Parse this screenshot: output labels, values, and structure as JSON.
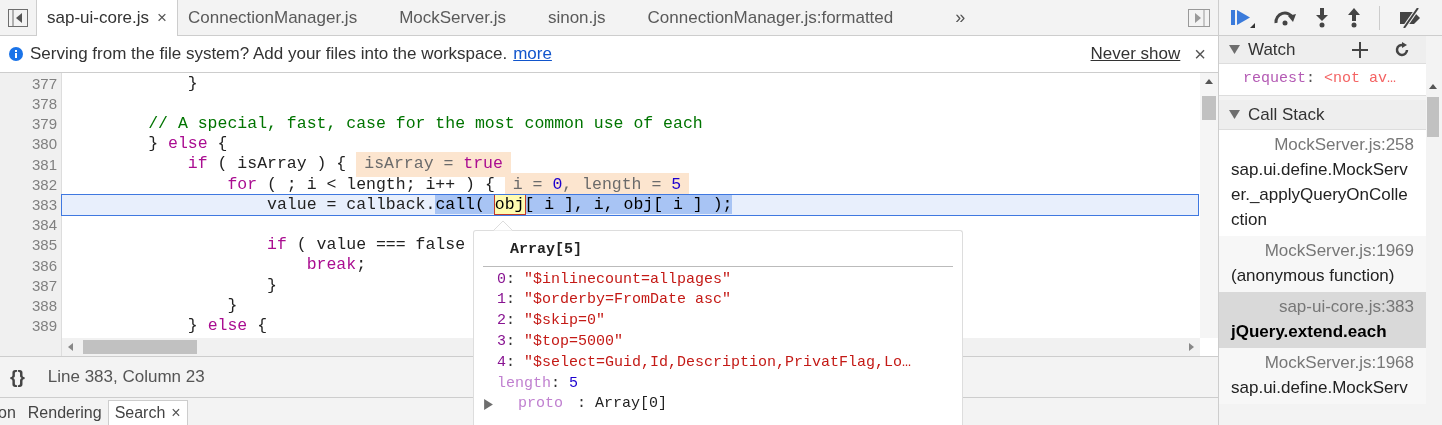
{
  "editor_tabs": [
    {
      "label": "sap-ui-core.js",
      "selected": true,
      "close": "×"
    },
    {
      "label": "ConnectionManager.js",
      "selected": false
    },
    {
      "label": "MockServer.js",
      "selected": false
    },
    {
      "label": "sinon.js",
      "selected": false
    },
    {
      "label": "ConnectionManager.js:formatted",
      "selected": false
    }
  ],
  "tabs_overflow": "»",
  "infobar": {
    "message": "Serving from the file system? Add your files into the workspace.",
    "link": "more",
    "dismiss": "Never show",
    "close": "×"
  },
  "code": {
    "lines": [
      {
        "number": "377",
        "highlighted": false,
        "tokens": [
          {
            "kind": "text",
            "text": "            }"
          }
        ]
      },
      {
        "number": "378",
        "highlighted": false
      },
      {
        "number": "379",
        "highlighted": false,
        "tokens": [
          {
            "kind": "comment",
            "text": "        // A special, fast, case for the most common use of each"
          }
        ]
      },
      {
        "number": "380",
        "highlighted": false,
        "tokens": [
          {
            "kind": "text",
            "text": "        } "
          },
          {
            "kind": "keyword",
            "text": "else"
          },
          {
            "kind": "text",
            "text": " {"
          }
        ]
      },
      {
        "number": "381",
        "highlighted": false,
        "tokens": [
          {
            "kind": "keyword",
            "text": "            if"
          },
          {
            "kind": "text",
            "text": " ( isArray ) {"
          }
        ],
        "annotation": [
          {
            "kind": "text",
            "text": "isArray = "
          },
          {
            "kind": "keyword",
            "text": "true"
          }
        ]
      },
      {
        "number": "382",
        "highlighted": false,
        "tokens": [
          {
            "kind": "keyword",
            "text": "                for"
          },
          {
            "kind": "text",
            "text": " ( ; i < length; i++ ) {"
          }
        ],
        "annotation": [
          {
            "kind": "text",
            "text": "i = "
          },
          {
            "kind": "number",
            "text": "0"
          },
          {
            "kind": "text",
            "text": ", length = "
          },
          {
            "kind": "number",
            "text": "5"
          }
        ]
      },
      {
        "number": "383",
        "highlighted": true,
        "tokens": [
          {
            "kind": "text",
            "text": "                    value = callback."
          },
          {
            "kind": "selection",
            "text": "call( "
          },
          {
            "kind": "hover",
            "text": "obj"
          },
          {
            "kind": "selection",
            "text": "[ i ], i, obj[ i ] );"
          }
        ]
      },
      {
        "number": "384",
        "highlighted": false
      },
      {
        "number": "385",
        "highlighted": false,
        "tokens": [
          {
            "kind": "keyword",
            "text": "                    if"
          },
          {
            "kind": "text",
            "text": " ( value === false"
          }
        ]
      },
      {
        "number": "386",
        "highlighted": false,
        "tokens": [
          {
            "kind": "keyword",
            "text": "                        break"
          },
          {
            "kind": "text",
            "text": ";"
          }
        ]
      },
      {
        "number": "387",
        "highlighted": false,
        "tokens": [
          {
            "kind": "text",
            "text": "                    }"
          }
        ]
      },
      {
        "number": "388",
        "highlighted": false,
        "tokens": [
          {
            "kind": "text",
            "text": "                }"
          }
        ]
      },
      {
        "number": "389",
        "highlighted": false,
        "tokens": [
          {
            "kind": "text",
            "text": "            } "
          },
          {
            "kind": "keyword",
            "text": "else"
          },
          {
            "kind": "text",
            "text": " {"
          }
        ]
      }
    ]
  },
  "popover": {
    "title": "Array[5]",
    "separator": ":",
    "entries": [
      {
        "key": "0",
        "value": "\"$inlinecount=allpages\"",
        "kind": "string",
        "enumerable": true
      },
      {
        "key": "1",
        "value": "\"$orderby=FromDate asc\"",
        "kind": "string",
        "enumerable": true
      },
      {
        "key": "2",
        "value": "\"$skip=0\"",
        "kind": "string",
        "enumerable": true
      },
      {
        "key": "3",
        "value": "\"$top=5000\"",
        "kind": "string",
        "enumerable": true
      },
      {
        "key": "4",
        "value": "\"$select=Guid,Id,Description,PrivatFlag,Lo…",
        "kind": "string",
        "enumerable": true
      },
      {
        "key": "length",
        "value": "5",
        "kind": "number",
        "enumerable": false
      },
      {
        "key": "proto",
        "value": "Array[0]",
        "kind": "object",
        "enumerable": false,
        "expanded": false
      }
    ]
  },
  "status_bar": {
    "format_button": "{}",
    "position": "Line 383, Column 23"
  },
  "drawer_tabs": [
    {
      "label": "on",
      "selected": false
    },
    {
      "label": "Rendering",
      "selected": false
    },
    {
      "label": "Search",
      "selected": true,
      "close": "×"
    }
  ],
  "sidebar": {
    "watch": {
      "title": "Watch",
      "expanded": true,
      "items": [
        {
          "name": "request",
          "separator": ":",
          "value": "<not av…"
        }
      ]
    },
    "call_stack": {
      "title": "Call Stack",
      "expanded": true,
      "frames": [
        {
          "location": "MockServer.js:258",
          "name": "sap.ui.define.MockServer._applyQueryOnCollection",
          "selected": false
        },
        {
          "location": "MockServer.js:1969",
          "name": "(anonymous function)",
          "selected": false
        },
        {
          "location": "sap-ui-core.js:383",
          "name": "jQuery.extend.each",
          "selected": true
        },
        {
          "location": "MockServer.js:1968",
          "name": "sap.ui.define.MockServ",
          "selected": false
        }
      ]
    }
  }
}
